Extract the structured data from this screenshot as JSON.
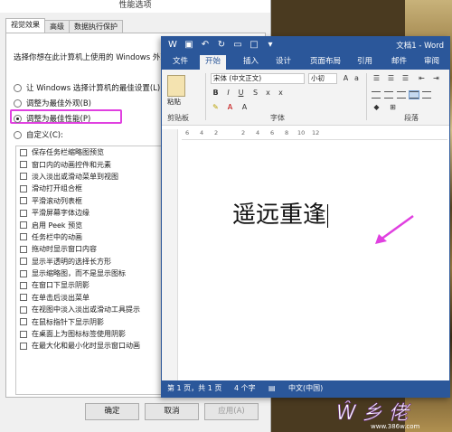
{
  "perf_dialog": {
    "title": "性能选项",
    "tabs": [
      "视觉效果",
      "高级",
      "数据执行保护"
    ],
    "description": "选择你想在此计算机上使用的 Windows 外观",
    "options": [
      {
        "label": "让 Windows 选择计算机的最佳设置(L)",
        "checked": false
      },
      {
        "label": "调整为最佳外观(B)",
        "checked": false
      },
      {
        "label": "调整为最佳性能(P)",
        "checked": true
      },
      {
        "label": "自定义(C):",
        "checked": false
      }
    ],
    "effects": [
      "保存任务栏缩略图预览",
      "窗口内的动画控件和元素",
      "淡入淡出或滑动菜单到视图",
      "滑动打开组合框",
      "平滑滚动列表框",
      "平滑屏幕字体边缘",
      "启用 Peek 预览",
      "任务栏中的动画",
      "拖动时显示窗口内容",
      "显示半透明的选择长方形",
      "显示缩略图，而不是显示图标",
      "在窗口下显示阴影",
      "在单击后淡出菜单",
      "在视图中淡入淡出或滑动工具提示",
      "在鼠标指针下显示阴影",
      "在桌面上为图标标签使用阴影",
      "在最大化和最小化时显示窗口动画"
    ],
    "buttons": {
      "ok": "确定",
      "cancel": "取消",
      "apply": "应用(A)"
    }
  },
  "word": {
    "title": "文档1 - Word",
    "tabs": [
      "文件",
      "开始",
      "插入",
      "设计",
      "页面布局",
      "引用",
      "邮件",
      "审阅"
    ],
    "active_tab": "开始",
    "font_name": "宋体 (中文正文)",
    "font_size": "小初",
    "paste_label": "粘贴",
    "groups": {
      "clipboard": "剪贴板",
      "font": "字体",
      "paragraph": "段落"
    },
    "ruler_marks": [
      "6",
      "4",
      "2",
      "2",
      "4",
      "6",
      "8",
      "10",
      "12"
    ],
    "document_text": "遥远重逢",
    "status": {
      "page": "第 1 页，共 1 页",
      "words": "4 个字",
      "language": "中文(中国)"
    }
  },
  "accent": "#2b579a",
  "highlight_color": "#e040e0",
  "watermark": "www.386w.com"
}
